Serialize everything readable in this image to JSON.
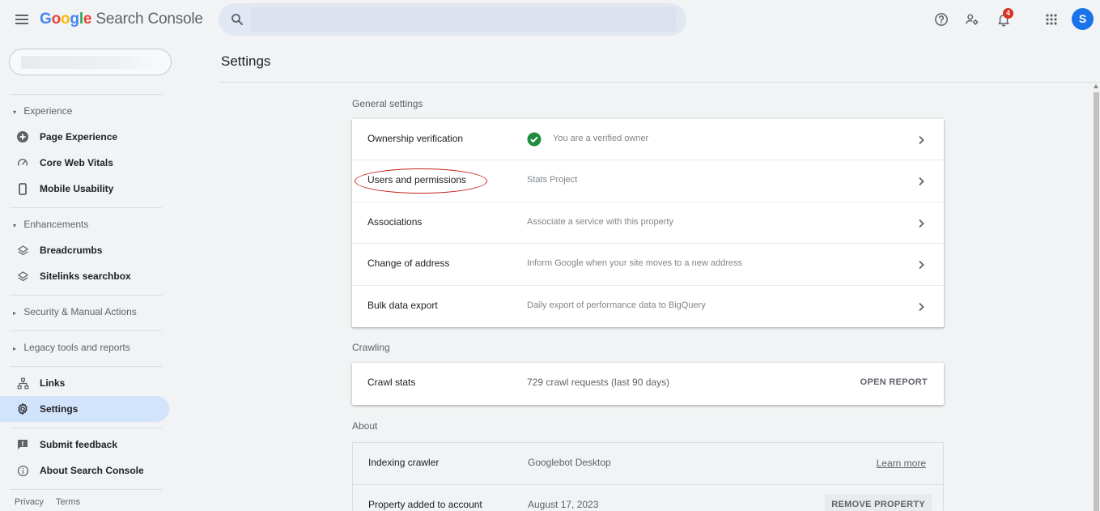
{
  "app": {
    "logo_letters": [
      {
        "ch": "G",
        "color": "#4285f4"
      },
      {
        "ch": "o",
        "color": "#ea4335"
      },
      {
        "ch": "o",
        "color": "#fbbc05"
      },
      {
        "ch": "g",
        "color": "#4285f4"
      },
      {
        "ch": "l",
        "color": "#34a853"
      },
      {
        "ch": "e",
        "color": "#ea4335"
      }
    ],
    "product_name": "Search Console"
  },
  "topbar": {
    "search_placeholder": "",
    "icons": [
      "help-icon",
      "manage-users-icon",
      "notifications-icon",
      "apps-grid-icon"
    ],
    "notification_count": "4",
    "avatar_initial": "S",
    "avatar_color": "#1a73e8"
  },
  "sidebar": {
    "sections": {
      "experience": "Experience",
      "enhancements": "Enhancements",
      "security": "Security & Manual Actions",
      "legacy": "Legacy tools and reports"
    },
    "items": {
      "page_experience": "Page Experience",
      "core_web_vitals": "Core Web Vitals",
      "mobile_usability": "Mobile Usability",
      "breadcrumbs": "Breadcrumbs",
      "sitelinks_searchbox": "Sitelinks searchbox",
      "links": "Links",
      "settings": "Settings",
      "submit_feedback": "Submit feedback",
      "about": "About Search Console"
    },
    "footer": {
      "privacy": "Privacy",
      "terms": "Terms"
    }
  },
  "main": {
    "page_title": "Settings",
    "general": {
      "label": "General settings",
      "rows": {
        "ownership": {
          "title": "Ownership verification",
          "desc": "You are a verified owner"
        },
        "users": {
          "title": "Users and permissions",
          "desc": "Stats Project"
        },
        "associations": {
          "title": "Associations",
          "desc": "Associate a service with this property"
        },
        "change_address": {
          "title": "Change of address",
          "desc": "Inform Google when your site moves to a new address"
        },
        "bulk_export": {
          "title": "Bulk data export",
          "desc": "Daily export of performance data to BigQuery"
        }
      }
    },
    "crawling": {
      "label": "Crawling",
      "crawl_stats": {
        "title": "Crawl stats",
        "desc": "729 crawl requests (last 90 days)",
        "action": "OPEN REPORT"
      }
    },
    "about": {
      "label": "About",
      "indexing": {
        "title": "Indexing crawler",
        "value": "Googlebot Desktop",
        "link": "Learn more"
      },
      "added": {
        "title": "Property added to account",
        "value": "August 17, 2023",
        "action": "REMOVE PROPERTY"
      }
    }
  },
  "colors": {
    "accent_blue": "#1a73e8",
    "verified_green": "#1e8e3e",
    "active_nav_bg": "#d2e3fc",
    "annotation_red": "#c5221f",
    "badge_red": "#d93025"
  }
}
